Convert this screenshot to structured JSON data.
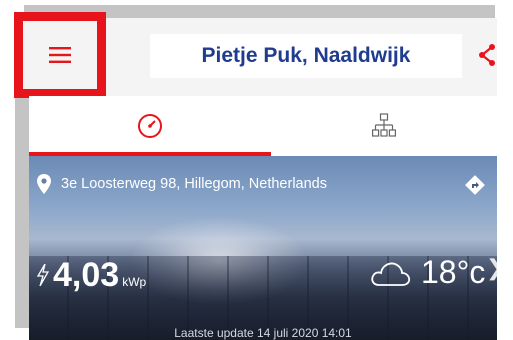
{
  "header": {
    "title": "Pietje Puk, Naaldwijk",
    "menu_icon": "hamburger-menu-icon",
    "share_icon": "share-icon",
    "accent_color": "#e8141b",
    "title_color": "#1f3c8f"
  },
  "tabs": [
    {
      "icon": "speedometer-icon",
      "active": true
    },
    {
      "icon": "hierarchy-icon",
      "active": false
    }
  ],
  "site": {
    "address": "3e Loosterweg 98, Hillegom, Netherlands",
    "location_icon": "location-pin-icon",
    "navigate_icon": "directions-icon"
  },
  "power": {
    "value": "4,03",
    "unit": "kWp",
    "icon": "lightning-icon"
  },
  "weather": {
    "icon": "cloud-icon",
    "temperature": "18°c"
  },
  "status": {
    "last_update": "Laatste update 14 juli 2020 14:01"
  }
}
